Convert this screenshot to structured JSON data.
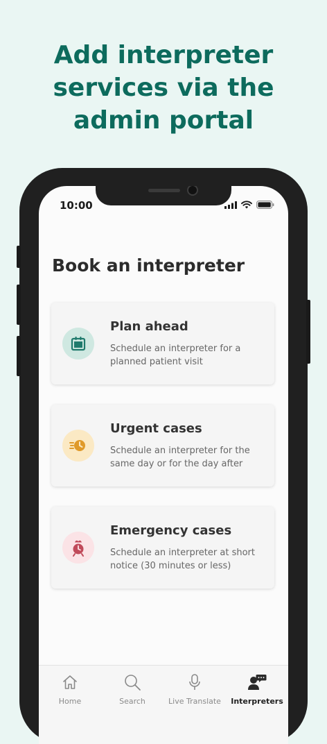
{
  "headline": {
    "line1": "Add interpreter",
    "line2": "services via the",
    "line3": "admin portal"
  },
  "status_bar": {
    "time": "10:00",
    "icons": [
      "cellular-signal-icon",
      "wifi-icon",
      "battery-icon"
    ]
  },
  "page": {
    "title": "Book an interpreter"
  },
  "cards": [
    {
      "title": "Plan ahead",
      "description": "Schedule an interpreter for a planned patient visit",
      "icon": "calendar-icon",
      "icon_color": "#1f7a6c",
      "icon_bg": "#cfe8e1"
    },
    {
      "title": "Urgent cases",
      "description": "Schedule an interpreter for the same day or for the day after",
      "icon": "urgent-clock-icon",
      "icon_color": "#e09a2a",
      "icon_bg": "#fbe9c4"
    },
    {
      "title": "Emergency cases",
      "description": "Schedule an interpreter at short notice (30 minutes or less)",
      "icon": "emergency-alarm-icon",
      "icon_color": "#c04a5a",
      "icon_bg": "#fbe3e6"
    }
  ],
  "tab_bar": {
    "items": [
      {
        "label": "Home",
        "icon": "home-icon"
      },
      {
        "label": "Search",
        "icon": "search-icon"
      },
      {
        "label": "Live Translate",
        "icon": "microphone-icon"
      },
      {
        "label": "Interpreters",
        "icon": "interpreter-icon",
        "active": true
      }
    ]
  },
  "colors": {
    "background": "#eaf6f3",
    "headline": "#0d6b5d",
    "phone_frame": "#202020"
  }
}
